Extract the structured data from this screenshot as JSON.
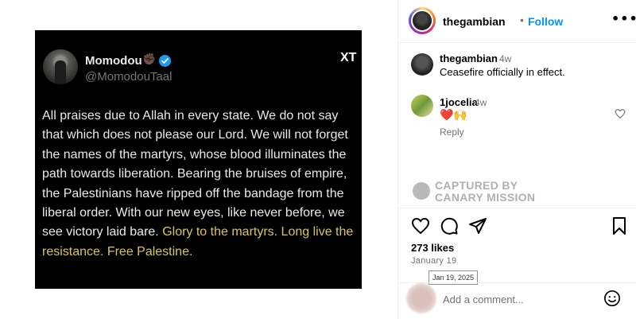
{
  "tweet": {
    "corner_mark": "XT",
    "name": "Momodou",
    "emoji": "✊🏿",
    "handle": "@MomodouTaal",
    "body": "All praises due to Allah in every state. We do not say that which does not please our Lord. We will not forget the names of the martyrs, whose blood illuminates the path towards liberation. Bearing the bruises of empire, the Palestinians have ripped off the bandage from the liberal order. With our new eyes, like never before, we see victory laid bare.",
    "highlight": "Glory to the martyrs. Long live the resistance. Free Palestine."
  },
  "header": {
    "username": "thegambian",
    "separator": "•",
    "follow_label": "Follow",
    "more_label": "•••"
  },
  "caption": {
    "username": "thegambian",
    "time": "4w",
    "text": "Ceasefire officially in effect."
  },
  "comment": {
    "username": "1jocelia",
    "time": "4w",
    "text": "❤️🙌",
    "reply_label": "Reply"
  },
  "watermark": {
    "line1": "CAPTURED BY",
    "line2": "CANARY MISSION"
  },
  "stats": {
    "likes": "273 likes",
    "date": "January 19",
    "tooltip": "Jan 19, 2025"
  },
  "add_comment": {
    "placeholder": "Add a comment..."
  },
  "colors": {
    "follow": "#0095f6",
    "highlight": "#d9c45c",
    "verified": "#1d9bf0"
  },
  "icons": [
    "heart-icon",
    "comment-icon",
    "share-icon",
    "bookmark-icon",
    "emoji-icon",
    "verified-icon",
    "more-icon"
  ]
}
